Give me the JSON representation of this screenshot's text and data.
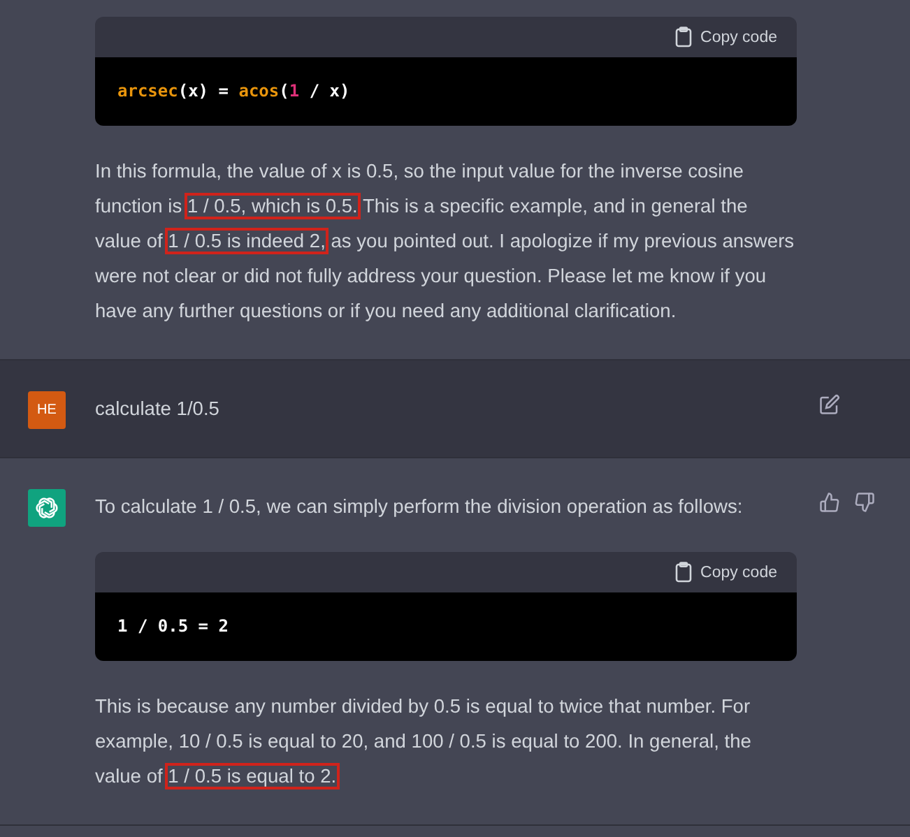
{
  "messages": [
    {
      "kind": "assistant",
      "blocks": [
        {
          "kind": "code",
          "copy_label": "Copy code",
          "tokens": [
            {
              "text": "arcsec",
              "kind": "function"
            },
            {
              "text": "(x) = ",
              "kind": "plain"
            },
            {
              "text": "acos",
              "kind": "function"
            },
            {
              "text": "(",
              "kind": "plain"
            },
            {
              "text": "1",
              "kind": "number"
            },
            {
              "text": " / x)",
              "kind": "plain"
            }
          ]
        },
        {
          "kind": "text",
          "segments": [
            {
              "text": "In this formula, the value of x is 0.5, so the input value for the inverse cosine function is ",
              "highlighted": false
            },
            {
              "text": "1 / 0.5, which is 0.5.",
              "highlighted": true
            },
            {
              "text": " This is a specific example, and in general the value of ",
              "highlighted": false
            },
            {
              "text": "1 / 0.5 is indeed 2,",
              "highlighted": true
            },
            {
              "text": " as you pointed out. I apologize if my previous answers were not clear or did not fully address your question. Please let me know if you have any further questions or if you need any additional clarification.",
              "highlighted": false
            }
          ]
        }
      ]
    },
    {
      "kind": "user",
      "avatar": "HE",
      "blocks": [
        {
          "kind": "text",
          "segments": [
            {
              "text": "calculate 1/0.5",
              "highlighted": false
            }
          ]
        }
      ]
    },
    {
      "kind": "assistant",
      "blocks": [
        {
          "kind": "text",
          "segments": [
            {
              "text": "To calculate 1 / 0.5, we can simply perform the division operation as follows:",
              "highlighted": false
            }
          ]
        },
        {
          "kind": "code",
          "copy_label": "Copy code",
          "tokens": [
            {
              "text": "1 / 0.5 = 2",
              "kind": "plain"
            }
          ]
        },
        {
          "kind": "text",
          "segments": [
            {
              "text": "This is because any number divided by 0.5 is equal to twice that number. For example, 10 / 0.5 is equal to 20, and 100 / 0.5 is equal to 200. In general, the value of ",
              "highlighted": false
            },
            {
              "text": "1 / 0.5 is equal to 2.",
              "highlighted": true
            }
          ]
        }
      ]
    }
  ]
}
